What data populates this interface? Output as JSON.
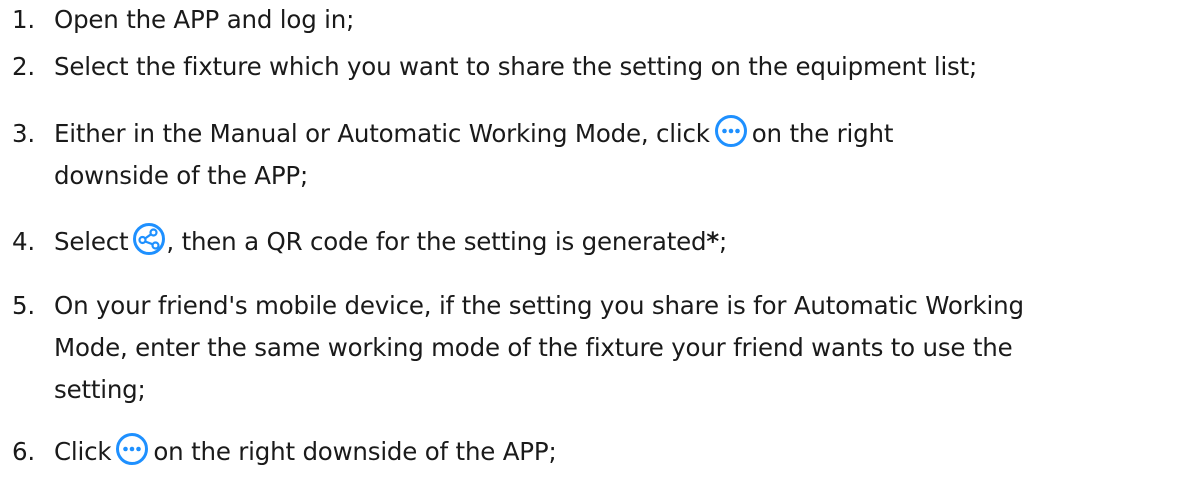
{
  "steps": [
    {
      "num": "1.",
      "lines": [
        "Open the APP and log in;"
      ]
    },
    {
      "num": "2.",
      "lines": [
        "Select the fixture which you want to share the setting on the equipment list;"
      ]
    },
    {
      "num": "3.",
      "before_icon": "Either in the Manual or Automatic Working Mode, click",
      "after_icon": "on the right",
      "lines": [
        "downside of the APP;"
      ],
      "icon": "more-icon"
    },
    {
      "num": "4.",
      "before_icon": "Select",
      "after_icon": ", then a QR code for the setting is generated",
      "mark": "*",
      "end": ";",
      "icon": "share-icon"
    },
    {
      "num": "5.",
      "lines": [
        "On your friend's mobile device, if the setting you share is for Automatic Working",
        "Mode, enter the same working mode of the fixture your friend wants to use the",
        "setting;"
      ]
    },
    {
      "num": "6.",
      "before_icon": "Click",
      "after_icon": "on the right downside of the APP;",
      "icon": "more-icon"
    }
  ],
  "colors": {
    "text": "#1a1a1a",
    "icon": "#1e90ff"
  }
}
